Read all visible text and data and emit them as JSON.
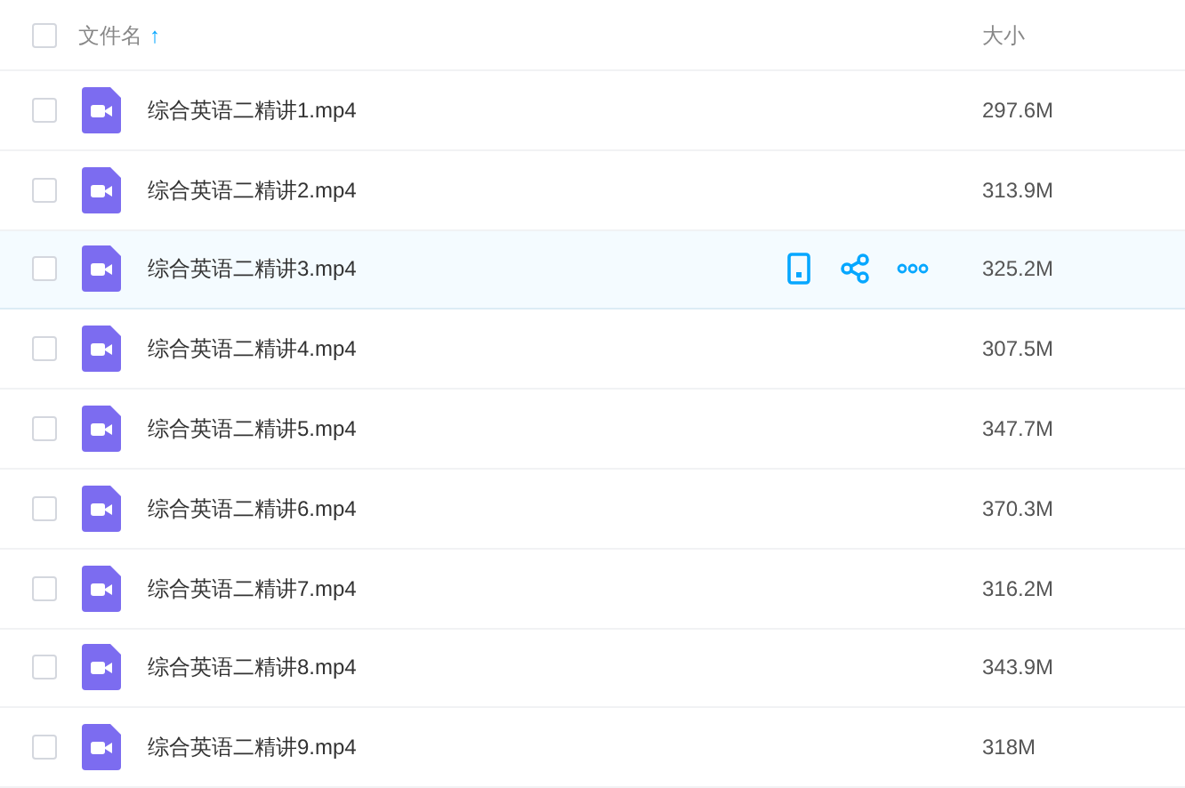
{
  "header": {
    "checked": false,
    "name_label": "文件名",
    "sort_icon": "↑",
    "size_label": "大小"
  },
  "rows": [
    {
      "name": "综合英语二精讲1.mp4",
      "size": "297.6M",
      "checked": false,
      "hovered": false
    },
    {
      "name": "综合英语二精讲2.mp4",
      "size": "313.9M",
      "checked": false,
      "hovered": false
    },
    {
      "name": "综合英语二精讲3.mp4",
      "size": "325.2M",
      "checked": false,
      "hovered": true
    },
    {
      "name": "综合英语二精讲4.mp4",
      "size": "307.5M",
      "checked": false,
      "hovered": false
    },
    {
      "name": "综合英语二精讲5.mp4",
      "size": "347.7M",
      "checked": false,
      "hovered": false
    },
    {
      "name": "综合英语二精讲6.mp4",
      "size": "370.3M",
      "checked": false,
      "hovered": false
    },
    {
      "name": "综合英语二精讲7.mp4",
      "size": "316.2M",
      "checked": false,
      "hovered": false
    },
    {
      "name": "综合英语二精讲8.mp4",
      "size": "343.9M",
      "checked": false,
      "hovered": false
    },
    {
      "name": "综合英语二精讲9.mp4",
      "size": "318M",
      "checked": false,
      "hovered": false
    }
  ]
}
